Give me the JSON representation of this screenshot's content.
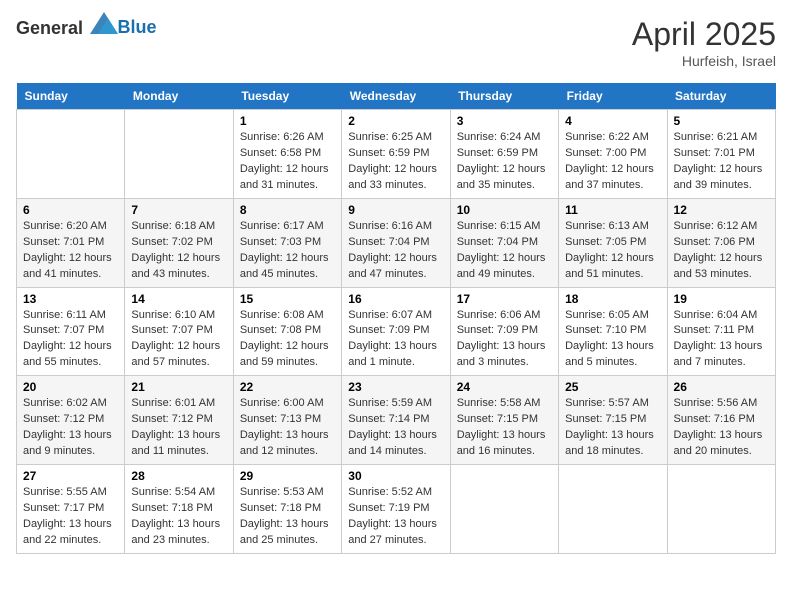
{
  "header": {
    "logo_general": "General",
    "logo_blue": "Blue",
    "month": "April 2025",
    "location": "Hurfeish, Israel"
  },
  "weekdays": [
    "Sunday",
    "Monday",
    "Tuesday",
    "Wednesday",
    "Thursday",
    "Friday",
    "Saturday"
  ],
  "weeks": [
    [
      {
        "day": "",
        "info": ""
      },
      {
        "day": "",
        "info": ""
      },
      {
        "day": "1",
        "info": "Sunrise: 6:26 AM\nSunset: 6:58 PM\nDaylight: 12 hours\nand 31 minutes."
      },
      {
        "day": "2",
        "info": "Sunrise: 6:25 AM\nSunset: 6:59 PM\nDaylight: 12 hours\nand 33 minutes."
      },
      {
        "day": "3",
        "info": "Sunrise: 6:24 AM\nSunset: 6:59 PM\nDaylight: 12 hours\nand 35 minutes."
      },
      {
        "day": "4",
        "info": "Sunrise: 6:22 AM\nSunset: 7:00 PM\nDaylight: 12 hours\nand 37 minutes."
      },
      {
        "day": "5",
        "info": "Sunrise: 6:21 AM\nSunset: 7:01 PM\nDaylight: 12 hours\nand 39 minutes."
      }
    ],
    [
      {
        "day": "6",
        "info": "Sunrise: 6:20 AM\nSunset: 7:01 PM\nDaylight: 12 hours\nand 41 minutes."
      },
      {
        "day": "7",
        "info": "Sunrise: 6:18 AM\nSunset: 7:02 PM\nDaylight: 12 hours\nand 43 minutes."
      },
      {
        "day": "8",
        "info": "Sunrise: 6:17 AM\nSunset: 7:03 PM\nDaylight: 12 hours\nand 45 minutes."
      },
      {
        "day": "9",
        "info": "Sunrise: 6:16 AM\nSunset: 7:04 PM\nDaylight: 12 hours\nand 47 minutes."
      },
      {
        "day": "10",
        "info": "Sunrise: 6:15 AM\nSunset: 7:04 PM\nDaylight: 12 hours\nand 49 minutes."
      },
      {
        "day": "11",
        "info": "Sunrise: 6:13 AM\nSunset: 7:05 PM\nDaylight: 12 hours\nand 51 minutes."
      },
      {
        "day": "12",
        "info": "Sunrise: 6:12 AM\nSunset: 7:06 PM\nDaylight: 12 hours\nand 53 minutes."
      }
    ],
    [
      {
        "day": "13",
        "info": "Sunrise: 6:11 AM\nSunset: 7:07 PM\nDaylight: 12 hours\nand 55 minutes."
      },
      {
        "day": "14",
        "info": "Sunrise: 6:10 AM\nSunset: 7:07 PM\nDaylight: 12 hours\nand 57 minutes."
      },
      {
        "day": "15",
        "info": "Sunrise: 6:08 AM\nSunset: 7:08 PM\nDaylight: 12 hours\nand 59 minutes."
      },
      {
        "day": "16",
        "info": "Sunrise: 6:07 AM\nSunset: 7:09 PM\nDaylight: 13 hours\nand 1 minute."
      },
      {
        "day": "17",
        "info": "Sunrise: 6:06 AM\nSunset: 7:09 PM\nDaylight: 13 hours\nand 3 minutes."
      },
      {
        "day": "18",
        "info": "Sunrise: 6:05 AM\nSunset: 7:10 PM\nDaylight: 13 hours\nand 5 minutes."
      },
      {
        "day": "19",
        "info": "Sunrise: 6:04 AM\nSunset: 7:11 PM\nDaylight: 13 hours\nand 7 minutes."
      }
    ],
    [
      {
        "day": "20",
        "info": "Sunrise: 6:02 AM\nSunset: 7:12 PM\nDaylight: 13 hours\nand 9 minutes."
      },
      {
        "day": "21",
        "info": "Sunrise: 6:01 AM\nSunset: 7:12 PM\nDaylight: 13 hours\nand 11 minutes."
      },
      {
        "day": "22",
        "info": "Sunrise: 6:00 AM\nSunset: 7:13 PM\nDaylight: 13 hours\nand 12 minutes."
      },
      {
        "day": "23",
        "info": "Sunrise: 5:59 AM\nSunset: 7:14 PM\nDaylight: 13 hours\nand 14 minutes."
      },
      {
        "day": "24",
        "info": "Sunrise: 5:58 AM\nSunset: 7:15 PM\nDaylight: 13 hours\nand 16 minutes."
      },
      {
        "day": "25",
        "info": "Sunrise: 5:57 AM\nSunset: 7:15 PM\nDaylight: 13 hours\nand 18 minutes."
      },
      {
        "day": "26",
        "info": "Sunrise: 5:56 AM\nSunset: 7:16 PM\nDaylight: 13 hours\nand 20 minutes."
      }
    ],
    [
      {
        "day": "27",
        "info": "Sunrise: 5:55 AM\nSunset: 7:17 PM\nDaylight: 13 hours\nand 22 minutes."
      },
      {
        "day": "28",
        "info": "Sunrise: 5:54 AM\nSunset: 7:18 PM\nDaylight: 13 hours\nand 23 minutes."
      },
      {
        "day": "29",
        "info": "Sunrise: 5:53 AM\nSunset: 7:18 PM\nDaylight: 13 hours\nand 25 minutes."
      },
      {
        "day": "30",
        "info": "Sunrise: 5:52 AM\nSunset: 7:19 PM\nDaylight: 13 hours\nand 27 minutes."
      },
      {
        "day": "",
        "info": ""
      },
      {
        "day": "",
        "info": ""
      },
      {
        "day": "",
        "info": ""
      }
    ]
  ]
}
